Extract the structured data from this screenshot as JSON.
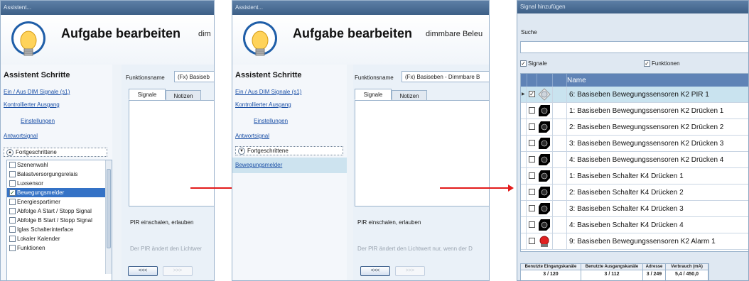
{
  "colors": {
    "accent": "#3472c6",
    "arrow": "#e31b1b",
    "titlebar": "#4a6d95",
    "grid_header": "#5f83b6",
    "selected_row": "#c9e3ef"
  },
  "panel1": {
    "window_title": "Assistent...",
    "header_title": "Aufgabe bearbeiten",
    "header_sub": "dim",
    "steps_title": "Assistent Schritte",
    "links": [
      "Ein / Aus DIM Signale (s1)",
      "Kontrollierter Ausgang",
      "Einstellungen",
      "Antwortsignal"
    ],
    "advanced_label": "Fortgeschrittene",
    "checklist": [
      {
        "label": "Szenenwahl",
        "checked": false
      },
      {
        "label": "Balastversorgungsrelais",
        "checked": false
      },
      {
        "label": "Luxsensor",
        "checked": false
      },
      {
        "label": "Bewegungsmelder",
        "checked": true
      },
      {
        "label": "Energiespartimer",
        "checked": false
      },
      {
        "label": "Abfolge A Start / Stopp Signal",
        "checked": false
      },
      {
        "label": "Abfolge B Start / Stopp Signal",
        "checked": false
      },
      {
        "label": "Iglas Schalterinterface",
        "checked": false
      },
      {
        "label": "Lokaler Kalender",
        "checked": false
      },
      {
        "label": "Funktionen",
        "checked": false
      }
    ],
    "function_label": "Funktionsname",
    "function_value": "(Fx) Basiseb",
    "tabs": [
      "Signale",
      "Notizen"
    ],
    "desc": "PIR einschalen, erlauben",
    "desc2": "Der PIR ändert den Lichtwer",
    "back_button": "<<<",
    "next_button": ">>>"
  },
  "panel2": {
    "window_title": "Assistent...",
    "header_title": "Aufgabe bearbeiten",
    "header_sub": "dimmbare Beleu",
    "steps_title": "Assistent Schritte",
    "links": [
      "Ein / Aus DIM Signale (s1)",
      "Kontrollierter Ausgang",
      "Einstellungen",
      "Antwortsignal"
    ],
    "advanced_label": "Fortgeschrittene",
    "selected_step": "Bewegungsmelder",
    "function_label": "Funktionsname",
    "function_value": "(Fx) Basiseben - Dimmbare B",
    "tabs": [
      "Signale",
      "Notizen"
    ],
    "desc": "PIR einschalen, erlauben",
    "desc2": "Der PIR ändert den Lichtwert nur, wenn der D",
    "back_button": "<<<",
    "next_button": ">>>"
  },
  "panel3": {
    "window_title": "Signal hinzufügen",
    "search_label": "Suche",
    "search_value": "",
    "filter_signals": "Signale",
    "filter_functions": "Funktionen",
    "column_name": "Name",
    "rows": [
      {
        "name": "6: Basiseben Bewegungssensoren K2 PIR 1",
        "checked": true,
        "icon": "pir-sensor-icon",
        "selected": true
      },
      {
        "name": "1: Basiseben Bewegungssensoren K2 Drücken 1",
        "checked": false,
        "icon": "push-button-icon",
        "selected": false
      },
      {
        "name": "2: Basiseben Bewegungssensoren K2 Drücken 2",
        "checked": false,
        "icon": "push-button-icon",
        "selected": false
      },
      {
        "name": "3: Basiseben Bewegungssensoren K2 Drücken 3",
        "checked": false,
        "icon": "push-button-icon",
        "selected": false
      },
      {
        "name": "4: Basiseben Bewegungssensoren K2 Drücken 4",
        "checked": false,
        "icon": "push-button-icon",
        "selected": false
      },
      {
        "name": "1: Basiseben Schalter K4 Drücken 1",
        "checked": false,
        "icon": "push-button-icon",
        "selected": false
      },
      {
        "name": "2: Basiseben Schalter K4 Drücken 2",
        "checked": false,
        "icon": "push-button-icon",
        "selected": false
      },
      {
        "name": "3: Basiseben Schalter K4 Drücken 3",
        "checked": false,
        "icon": "push-button-icon",
        "selected": false
      },
      {
        "name": "4: Basiseben Schalter K4 Drücken 4",
        "checked": false,
        "icon": "push-button-icon",
        "selected": false
      },
      {
        "name": "9: Basiseben Bewegungssensoren K2 Alarm 1",
        "checked": false,
        "icon": "alarm-icon",
        "selected": false
      }
    ],
    "stats": [
      {
        "label": "Benutzte Eingangskanäle",
        "value": "3 / 120"
      },
      {
        "label": "Benutzte Ausgangskanäle",
        "value": "3 / 112"
      },
      {
        "label": "Adresse",
        "value": "3 / 249"
      },
      {
        "label": "Verbrauch (mA)",
        "value": "5,4 / 450,0"
      }
    ]
  }
}
